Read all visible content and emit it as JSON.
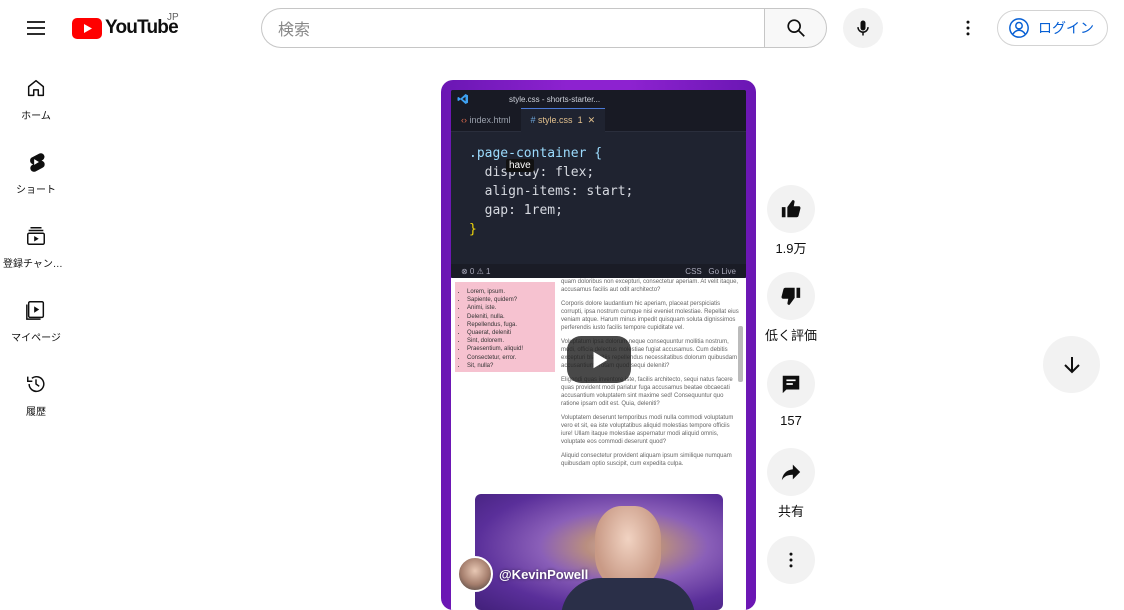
{
  "header": {
    "logo_text": "YouTube",
    "region": "JP",
    "search_placeholder": "検索",
    "login_label": "ログイン"
  },
  "sidebar": {
    "items": [
      {
        "label": "ホーム",
        "icon": "home-icon"
      },
      {
        "label": "ショート",
        "icon": "shorts-icon"
      },
      {
        "label": "登録チャンネル",
        "icon": "subscriptions-icon"
      },
      {
        "label": "マイページ",
        "icon": "library-icon"
      },
      {
        "label": "履歴",
        "icon": "history-icon"
      }
    ]
  },
  "player": {
    "caption": "have",
    "channel": "@KevinPowell",
    "editor": {
      "window_title": "style.css - shorts-starter...",
      "tabs": [
        "index.html",
        "style.css"
      ],
      "active_tab_badge": "1",
      "code_lines": [
        ".page-container {",
        "  display: flex;",
        "  align-items: start;",
        "  gap: 1rem;",
        "}"
      ],
      "status_left": "⊗ 0 ⚠ 1",
      "status_lang": "CSS",
      "status_live": "Go Live"
    },
    "list_items": [
      "Lorem, ipsum.",
      "Sapiente, quidem?",
      "Animi, iste.",
      "Deleniti, nulla.",
      "Repellendus, fuga.",
      "Quaerat, deleniti",
      "Sint, dolorem.",
      "Praesentium, aliquid!",
      "Consectetur, error.",
      "Sit, nulla?"
    ],
    "paragraphs": [
      "quam doloribus non excepturi, consectetur aperiam. At velit itaque, accusamus facilis aut odit architecto?",
      "Corporis dolore laudantium hic aperiam, placeat perspiciatis corrupti, ipsa nostrum cumque nisi eveniet molestiae. Repellat eius veniam atque. Harum minus impedit quisquam soluta dignissimos perferendis iusto facilis tempore cupiditate vel.",
      "Voluptatum ipsa dolorum neque consequuntur mollitia nostrum, modi, officia delectus molestiae fugiat accusamus. Cum debitis excepturi blanditiis repellendus necessitatibus dolorum quibusdam accusantium. Totam quod sequi deleniti?",
      "Eligendi quas inventore iste, facilis architecto, sequi natus facere quas provident modi pariatur fuga accusamus beatae obcaecati accusantium voluptatem sint maxime sed! Consequuntur quo ratione ipsam odit est. Quia, deleniti?",
      "Voluptatem deserunt temporibus modi nulla commodi voluptatum vero et sit, ea iste voluptatibus aliquid molestias tempore officiis iure! Ullam itaque molestiae aspernatur modi aliquid omnis, voluptate eos commodi deserunt quod?",
      "Aliquid consectetur provident aliquam ipsum similique numquam quibusdam optio suscipit, cum expedita culpa."
    ]
  },
  "actions": {
    "like": "1.9万",
    "dislike": "低く評価",
    "comments": "157",
    "share": "共有"
  },
  "colors": {
    "brand_red": "#ff0000",
    "link_blue": "#065fd4",
    "player_purple": "#8d22d0"
  }
}
